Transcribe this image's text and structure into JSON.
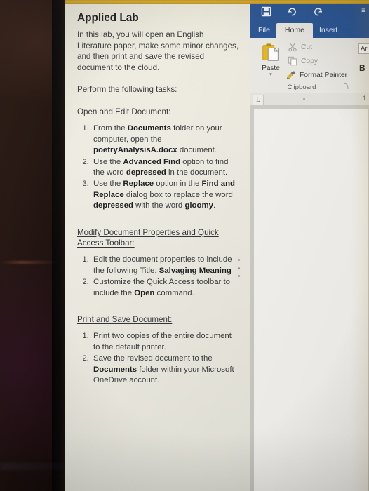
{
  "instructions": {
    "title": "Applied Lab",
    "intro": "In this lab, you will open an English Literature paper, make some minor changes, and then print and save the revised document to the cloud.",
    "perform": "Perform the following tasks:",
    "sections": [
      {
        "heading": "Open and Edit Document:",
        "items": [
          {
            "parts": [
              {
                "t": "From the ",
                "b": false
              },
              {
                "t": "Documents",
                "b": true
              },
              {
                "t": " folder on your computer, open the ",
                "b": false
              },
              {
                "t": "poetryAnalysisA.docx",
                "b": true
              },
              {
                "t": " document.",
                "b": false
              }
            ]
          },
          {
            "parts": [
              {
                "t": "Use the ",
                "b": false
              },
              {
                "t": "Advanced Find",
                "b": true
              },
              {
                "t": " option to find the word ",
                "b": false
              },
              {
                "t": "depressed",
                "b": true
              },
              {
                "t": " in the document.",
                "b": false
              }
            ]
          },
          {
            "parts": [
              {
                "t": "Use the ",
                "b": false
              },
              {
                "t": "Replace",
                "b": true
              },
              {
                "t": " option in the ",
                "b": false
              },
              {
                "t": "Find and Replace",
                "b": true
              },
              {
                "t": " dialog box to replace the word ",
                "b": false
              },
              {
                "t": "depressed",
                "b": true
              },
              {
                "t": " with the word ",
                "b": false
              },
              {
                "t": "gloomy",
                "b": true
              },
              {
                "t": ".",
                "b": false
              }
            ]
          }
        ]
      },
      {
        "heading": "Modify Document Properties and Quick Access Toolbar:",
        "items": [
          {
            "parts": [
              {
                "t": "Edit the document properties to include the following Title: ",
                "b": false
              },
              {
                "t": "Salvaging Meaning",
                "b": true
              }
            ]
          },
          {
            "parts": [
              {
                "t": "Customize the Quick Access toolbar to include the ",
                "b": false
              },
              {
                "t": "Open",
                "b": true
              },
              {
                "t": " command.",
                "b": false
              }
            ]
          }
        ]
      },
      {
        "heading": "Print and Save Document:",
        "items": [
          {
            "parts": [
              {
                "t": "Print two copies of the entire document to the default printer.",
                "b": false
              }
            ]
          },
          {
            "parts": [
              {
                "t": "Save the revised document to the ",
                "b": false
              },
              {
                "t": "Documents",
                "b": true
              },
              {
                "t": " folder within your Microsoft OneDrive account.",
                "b": false
              }
            ]
          }
        ]
      }
    ],
    "splitter_name": "pane-drag-handle"
  },
  "word": {
    "quick_access": [
      {
        "name": "save-icon",
        "label": "Save"
      },
      {
        "name": "undo-icon",
        "label": "Undo"
      },
      {
        "name": "redo-icon",
        "label": "Redo"
      }
    ],
    "qat_more": "≡",
    "tabs": [
      {
        "label": "File",
        "active": false
      },
      {
        "label": "Home",
        "active": true
      },
      {
        "label": "Insert",
        "active": false
      }
    ],
    "clipboard": {
      "paste_label": "Paste",
      "paste_caret": "▾",
      "cut_label": "Cut",
      "copy_label": "Copy",
      "format_painter_label": "Format Painter",
      "group_label": "Clipboard",
      "launcher_glyph": "⤵"
    },
    "font_group": {
      "font_name_value": "Ar",
      "bold_label": "B"
    },
    "ruler": {
      "tab_stop_glyph": "L",
      "mark_label": "1"
    }
  },
  "colors": {
    "word_blue": "#2b5797",
    "ribbon_bg": "#eceae4",
    "instr_bg": "#edeade",
    "gold_strip": "#c99a1c",
    "paste_gold": "#e8b925"
  }
}
